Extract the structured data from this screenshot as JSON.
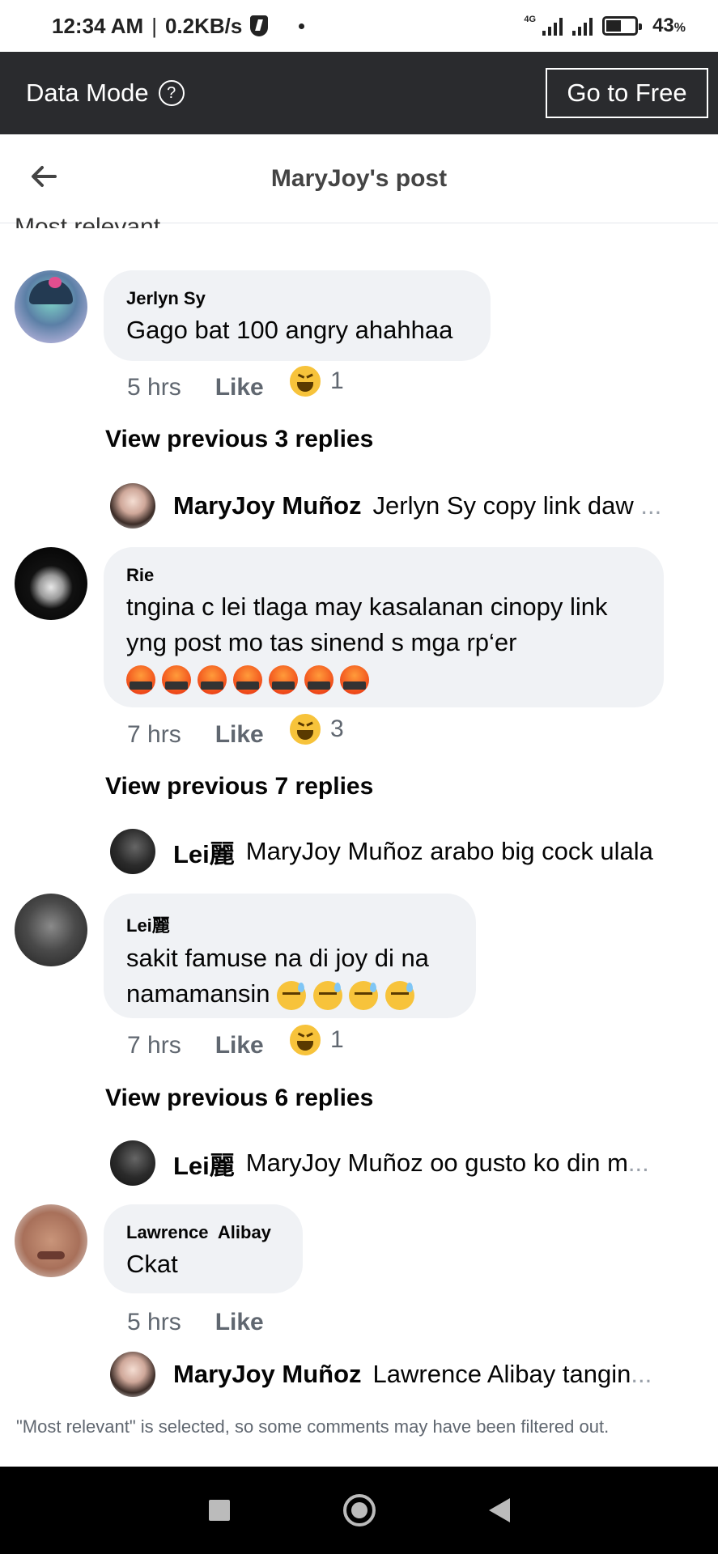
{
  "status_bar": {
    "time": "12:34 AM",
    "separator": "|",
    "speed": "0.2KB/s",
    "network_tag": "4G",
    "battery_percent": "43",
    "battery_unit": "%"
  },
  "data_mode": {
    "title": "Data Mode",
    "help_glyph": "?",
    "go_free_label": "Go to Free"
  },
  "header": {
    "title": "MaryJoy's post"
  },
  "sort": {
    "label": "Most relevant",
    "caret": "⌄"
  },
  "threads": [
    {
      "author": "Jerlyn Sy",
      "text": "Gago bat 100 angry ahahhaa",
      "time": "5 hrs",
      "like": "Like",
      "reaction_count": "1",
      "view_previous": "View previous 3 replies",
      "reply": {
        "author": "MaryJoy Muñoz",
        "text": "Jerlyn Sy copy link daw",
        "ellipsis": "..."
      }
    },
    {
      "author": "Rie",
      "text_line1": "tngina c lei tlaga may kasalanan cinopy link",
      "text_line2": "yng post mo tas sinend s mga rp‘er",
      "emoji_count": 7,
      "time": "7 hrs",
      "like": "Like",
      "reaction_count": "3",
      "view_previous": "View previous 7 replies",
      "reply": {
        "author": "Lei麗",
        "text": "MaryJoy Muñoz arabo big cock ulala",
        "ellipsis": ""
      }
    },
    {
      "author": "Lei麗",
      "text_line1": "sakit famuse na di joy di na",
      "text_line2": "namamansin",
      "time": "7 hrs",
      "like": "Like",
      "reaction_count": "1",
      "view_previous": "View previous 6 replies",
      "reply": {
        "author": "Lei麗",
        "text": "MaryJoy Muñoz oo gusto ko din m",
        "ellipsis": "..."
      }
    },
    {
      "author": "Lawrence  Alibay",
      "text": "Ckat",
      "time": "5 hrs",
      "like": "Like",
      "reply": {
        "author": "MaryJoy Muñoz",
        "text": "Lawrence Alibay tangin",
        "ellipsis": "..."
      }
    }
  ],
  "footer_note": "\"Most relevant\" is selected, so some comments may have been filtered out.",
  "icons": {
    "back": "left-arrow-icon",
    "help": "question-circle-icon",
    "reaction": "haha-emoji-icon",
    "angry_emoji": "pouting-face-symbols-emoji",
    "sad_emoji": "downcast-face-sweat-emoji"
  },
  "colors": {
    "data_mode_bg": "#2a2b2e",
    "bubble_bg": "#f0f2f5",
    "meta_text": "#606770",
    "nav_bar_bg": "#000000"
  }
}
